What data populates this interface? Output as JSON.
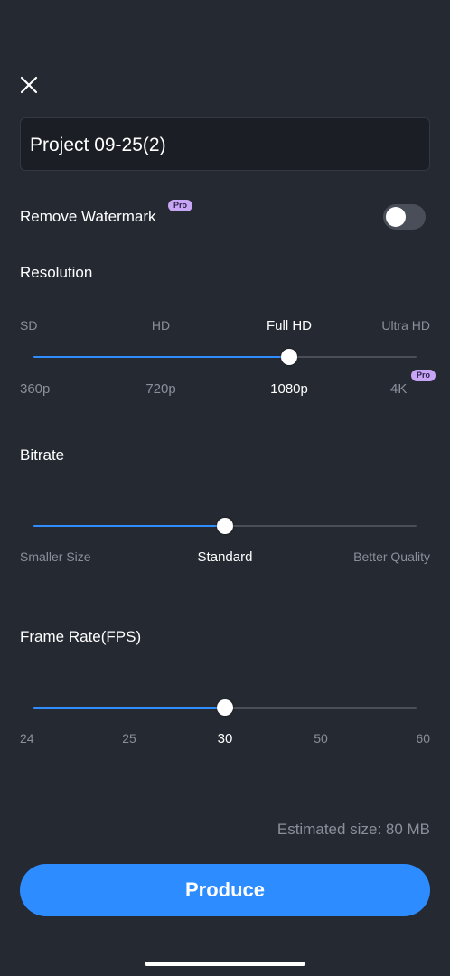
{
  "header": {
    "close_icon": "close-icon"
  },
  "project": {
    "name": "Project 09-25(2)"
  },
  "watermark": {
    "label": "Remove Watermark",
    "badge": "Pro",
    "enabled": false
  },
  "resolution": {
    "title": "Resolution",
    "tiers": [
      "SD",
      "HD",
      "Full HD",
      "Ultra HD"
    ],
    "values": [
      "360p",
      "720p",
      "1080p",
      "4K"
    ],
    "pro_badge": "Pro",
    "selected_index": 2
  },
  "bitrate": {
    "title": "Bitrate",
    "left_label": "Smaller Size",
    "center_label": "Standard",
    "right_label": "Better Quality",
    "level": 0.5
  },
  "frame_rate": {
    "title": "Frame Rate(FPS)",
    "options": [
      "24",
      "25",
      "30",
      "50",
      "60"
    ],
    "selected_index": 2
  },
  "estimate": {
    "text": "Estimated size: 80 MB"
  },
  "actions": {
    "produce_label": "Produce"
  },
  "colors": {
    "accent": "#2d8cff",
    "pro_badge": "#c8a6f5",
    "background": "#252932"
  }
}
